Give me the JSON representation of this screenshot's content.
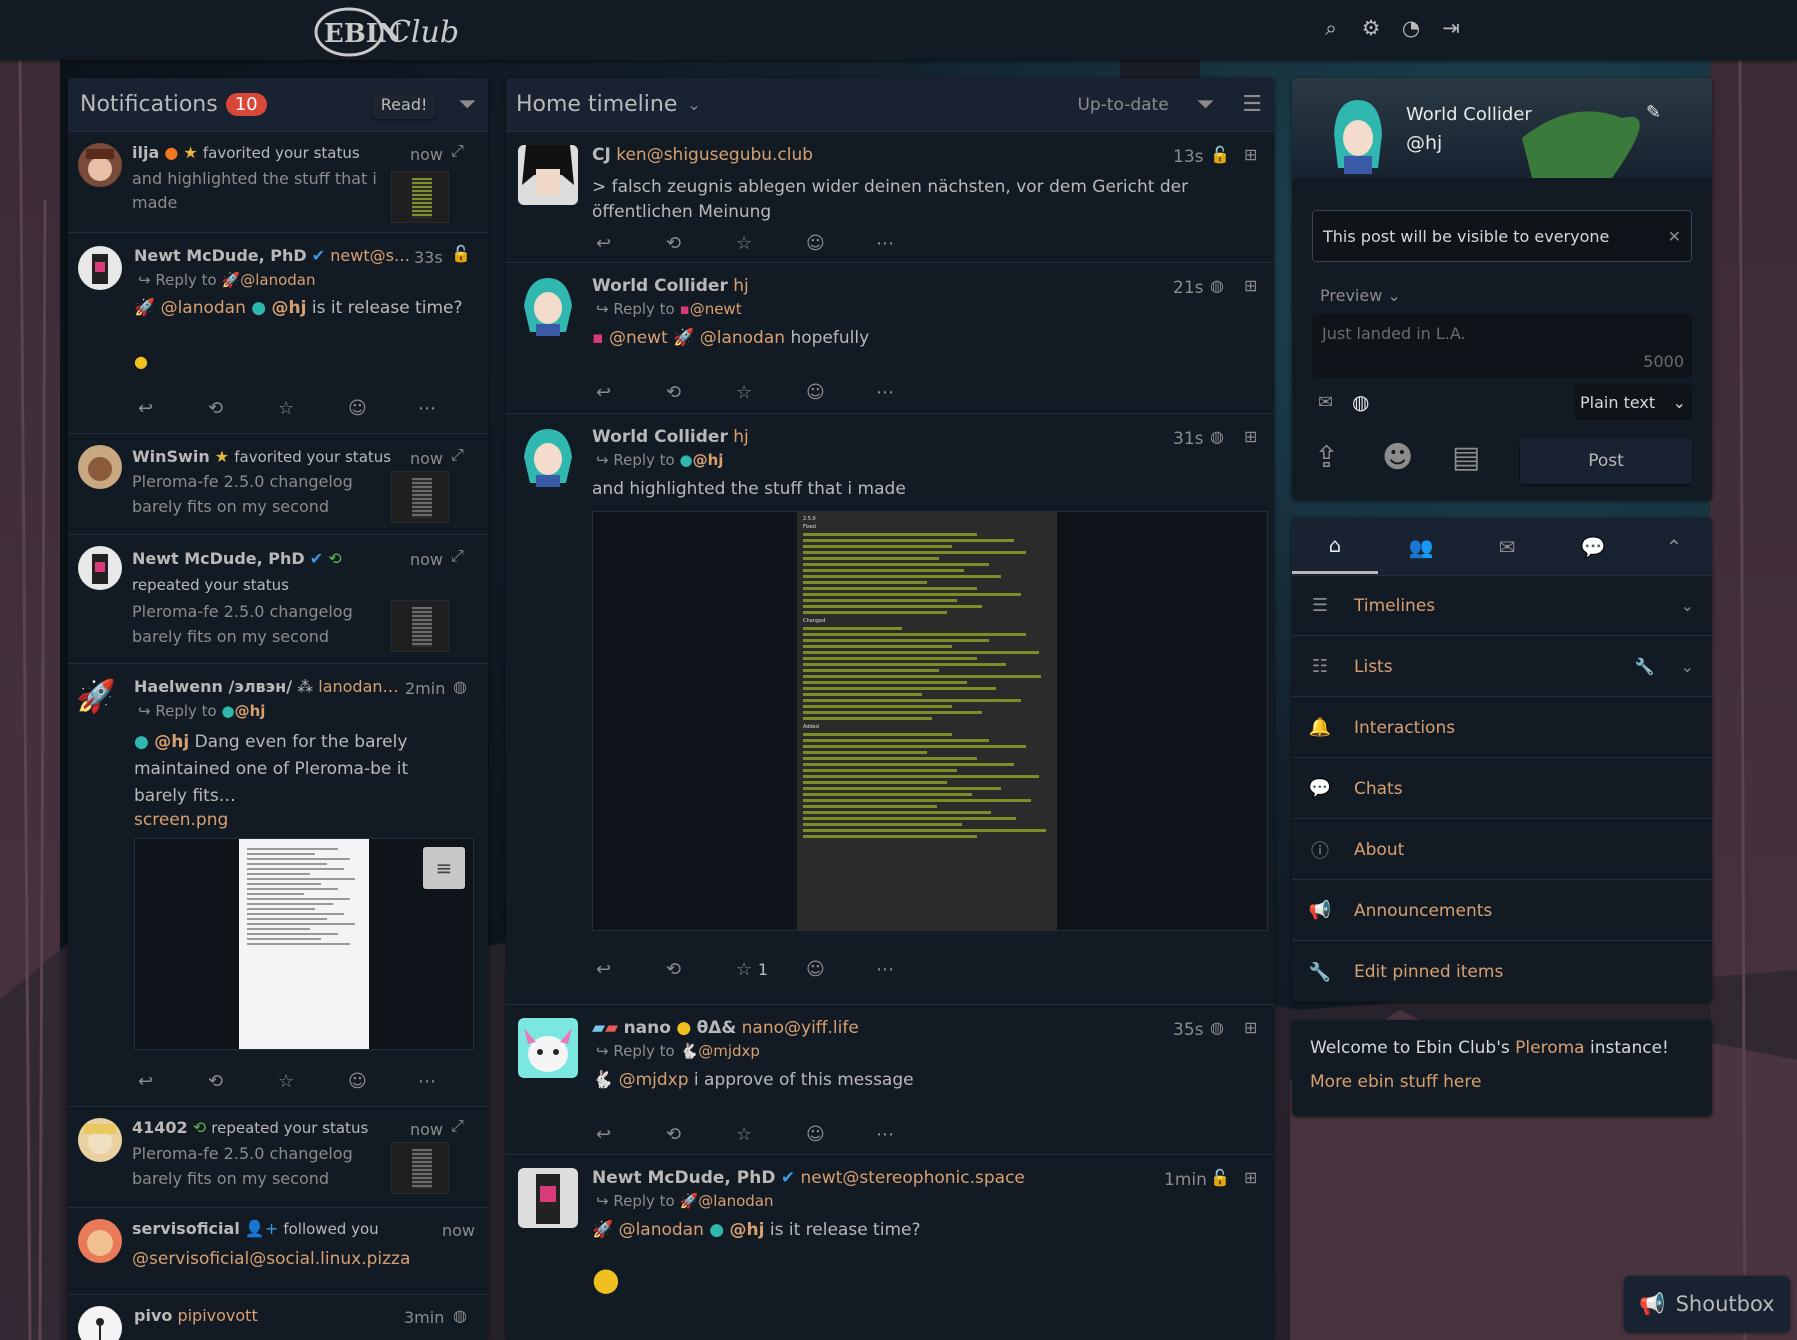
{
  "header": {
    "logo": "EBIN Club",
    "icons": [
      "search-icon",
      "gear-icon",
      "dashboard-icon",
      "logout-icon"
    ]
  },
  "notifications": {
    "title": "Notifications",
    "count": "10",
    "read_button": "Read!",
    "items": [
      {
        "name": "ilja",
        "action": "favorited your status",
        "time": "now",
        "preview": "and highlighted the stuff that i made"
      },
      {
        "name": "Newt McDude, PhD",
        "handle": "newt@s…",
        "time": "33s",
        "reply_label": "Reply to",
        "reply_target": "@lanodan",
        "m1": "@lanodan",
        "m2": "@hj",
        "text": "is it release time?"
      },
      {
        "name": "WinSwin",
        "action": "favorited your status",
        "time": "now",
        "preview": "Pleroma-fe 2.5.0 changelog barely fits on my second"
      },
      {
        "name": "Newt McDude, PhD",
        "action": "repeated your status",
        "time": "now",
        "preview": "Pleroma-fe 2.5.0 changelog barely fits on my second"
      },
      {
        "name": "Haelwenn /элвэн/",
        "handle": "lanodan…",
        "time": "2min",
        "reply_label": "Reply to",
        "reply_target": "@hj",
        "mention": "@hj",
        "text": "Dang even for the barely maintained one of Pleroma-be it barely fits…",
        "file": "screen.png"
      },
      {
        "name": "41402",
        "action": "repeated your status",
        "time": "now",
        "preview": "Pleroma-fe 2.5.0 changelog barely fits on my second"
      },
      {
        "name": "servisoficial",
        "action": "followed you",
        "time": "now",
        "handle": "@servisoficial@social.linux.pizza"
      },
      {
        "name": "pivo",
        "handle": "pipivovott",
        "time": "3min"
      }
    ]
  },
  "timeline": {
    "title": "Home timeline",
    "status": "Up-to-date",
    "posts": [
      {
        "name": "CJ",
        "handle": "ken@shigusegubu.club",
        "time": "13s",
        "text": "> falsch zeugnis ablegen wider deinen nächsten, vor dem Gericht der öffentlichen Meinung"
      },
      {
        "name": "World Collider",
        "handle": "hj",
        "time": "21s",
        "reply_label": "Reply to",
        "reply_target": "@newt",
        "m1": "@newt",
        "m2": "@lanodan",
        "text": "hopefully"
      },
      {
        "name": "World Collider",
        "handle": "hj",
        "time": "31s",
        "reply_label": "Reply to",
        "reply_target": "@hj",
        "text": "and highlighted the stuff that i made",
        "fav_count": "1",
        "doc_changed": "Changed",
        "doc_added": "Added",
        "doc_fixed": "Fixed",
        "doc_heading": "2.5.0"
      },
      {
        "name": "nano",
        "extra": "θΔ&",
        "handle": "nano@yiff.life",
        "time": "35s",
        "reply_label": "Reply to",
        "reply_target": "@mjdxp",
        "m1": "@mjdxp",
        "text": "i approve of this message"
      },
      {
        "name": "Newt McDude, PhD",
        "handle": "newt@stereophonic.space",
        "time": "1min",
        "reply_label": "Reply to",
        "reply_target": "@lanodan",
        "m1": "@lanodan",
        "m2": "@hj",
        "text": "is it release time?"
      }
    ]
  },
  "profile": {
    "name": "World Collider",
    "handle": "@hj"
  },
  "composer": {
    "visibility_notice": "This post will be visible to everyone",
    "preview": "Preview",
    "placeholder": "Just landed in L.A.",
    "char_count": "5000",
    "format": "Plain text",
    "post_button": "Post"
  },
  "nav": {
    "items": [
      {
        "label": "Timelines",
        "icon": "list-icon"
      },
      {
        "label": "Lists",
        "icon": "bullet-list-icon"
      },
      {
        "label": "Interactions",
        "icon": "bell-icon"
      },
      {
        "label": "Chats",
        "icon": "chat-icon"
      },
      {
        "label": "About",
        "icon": "info-icon"
      },
      {
        "label": "Announcements",
        "icon": "megaphone-icon"
      },
      {
        "label": "Edit pinned items",
        "icon": "wrench-icon"
      }
    ]
  },
  "instance": {
    "welcome_prefix": "Welcome to Ebin Club's",
    "welcome_link": "Pleroma",
    "welcome_suffix": "instance!",
    "more_link": "More ebin stuff here"
  },
  "shoutbox": {
    "label": "Shoutbox"
  }
}
